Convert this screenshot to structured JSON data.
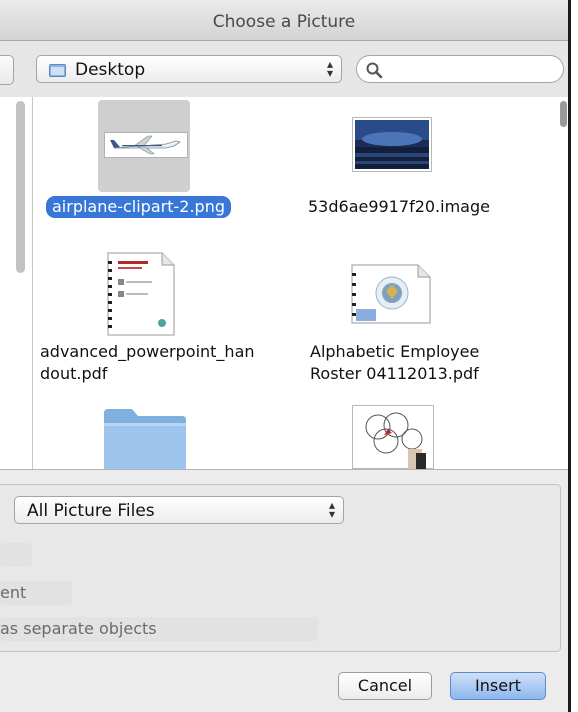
{
  "window": {
    "title": "Choose a Picture"
  },
  "toolbar": {
    "location": "Desktop",
    "search_placeholder": ""
  },
  "files": [
    {
      "name": "airplane-clipart-2.png",
      "selected": true,
      "icon": "airplane-image-thumbnail"
    },
    {
      "name": "53d6ae9917f20.image",
      "selected": false,
      "icon": "concert-photo-thumbnail"
    },
    {
      "name_line1": "advanced_powerpoint_han",
      "name_line2": "dout.pdf",
      "icon": "pdf-document-icon"
    },
    {
      "name_line1": "Alphabetic Employee",
      "name_line2": "Roster 04112013.pdf",
      "icon": "pdf-document-icon"
    },
    {
      "icon": "folder-icon"
    },
    {
      "icon": "diagram-image-thumbnail"
    }
  ],
  "options": {
    "filter": "All Picture Files",
    "partial_rows": [
      "ent",
      "as separate objects"
    ]
  },
  "buttons": {
    "cancel": "Cancel",
    "insert": "Insert"
  },
  "colors": {
    "selection": "#3876d7",
    "primary_button": "#8db7ee"
  }
}
